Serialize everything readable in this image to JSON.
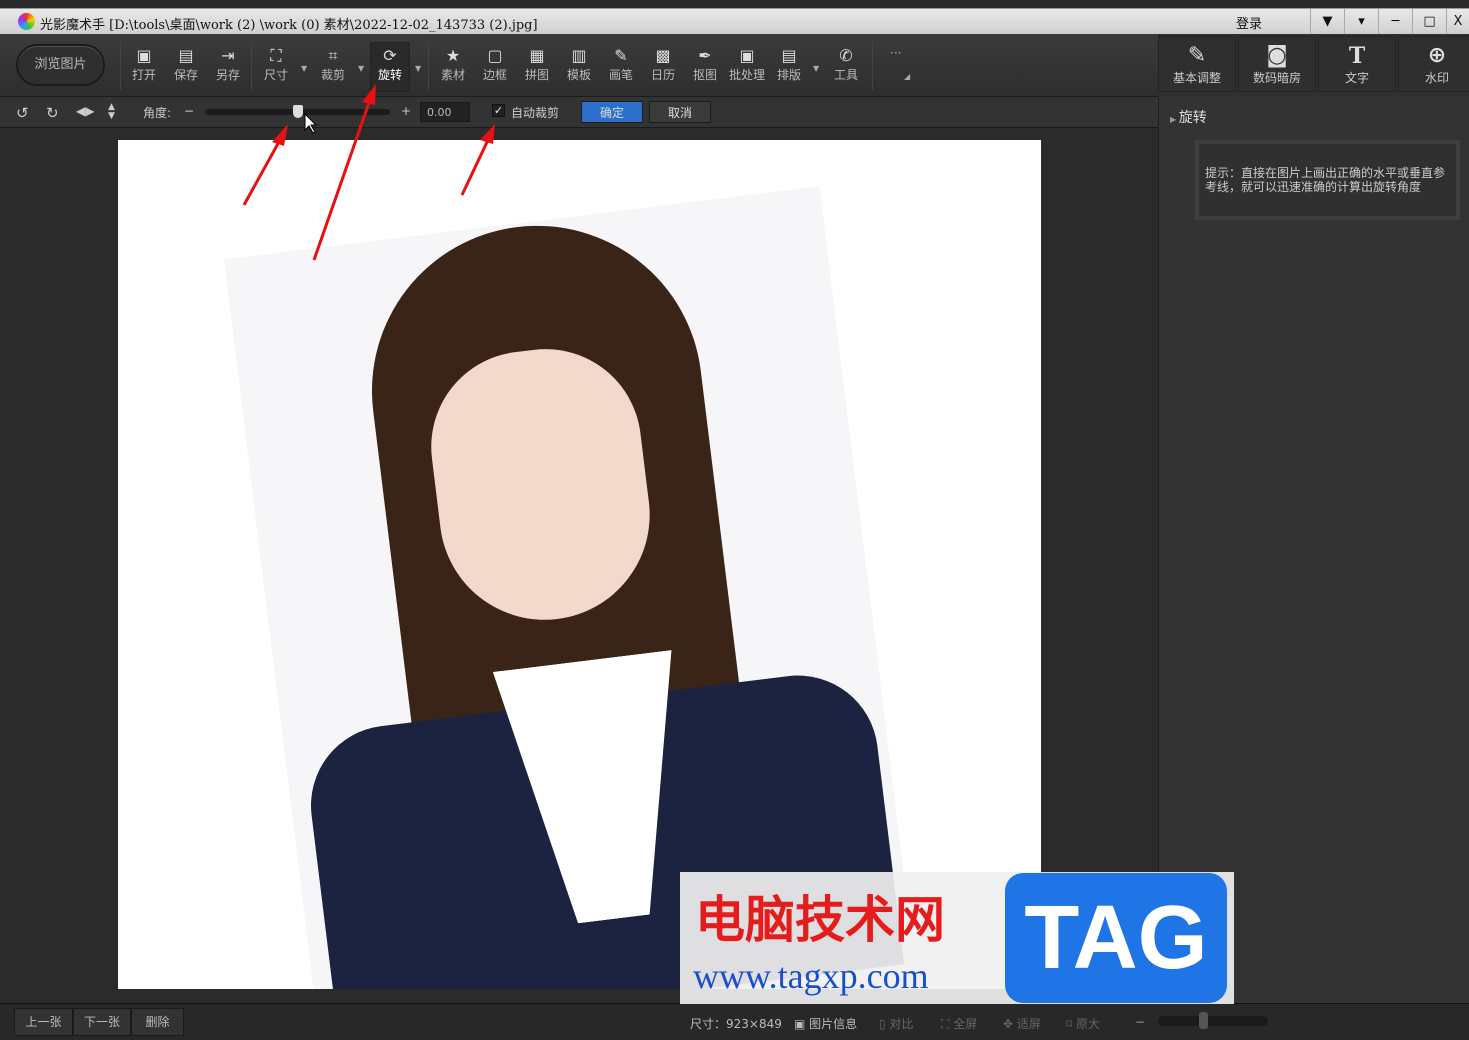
{
  "window": {
    "title": "光影魔术手  [D:\\tools\\桌面\\work (2) \\work (0) 素材\\2022-12-02_143733 (2).jpg]",
    "login": "登录",
    "controls": [
      "▼",
      "▾",
      "─",
      "□",
      "X"
    ]
  },
  "toolbar": {
    "browse": "浏览图片",
    "tools": [
      {
        "label": "打开",
        "icon": "open-icon",
        "glyph": "▣"
      },
      {
        "label": "保存",
        "icon": "save-icon",
        "glyph": "▤"
      },
      {
        "label": "另存",
        "icon": "saveas-icon",
        "glyph": "⇥"
      },
      {
        "label": "尺寸",
        "icon": "resize-icon",
        "glyph": "⛶"
      },
      {
        "label": "裁剪",
        "icon": "crop-icon",
        "glyph": "⌗"
      },
      {
        "label": "旋转",
        "icon": "rotate-icon",
        "glyph": "⟳"
      },
      {
        "label": "素材",
        "icon": "material-icon",
        "glyph": "★"
      },
      {
        "label": "边框",
        "icon": "border-icon",
        "glyph": "▢"
      },
      {
        "label": "拼图",
        "icon": "collage-icon",
        "glyph": "▦"
      },
      {
        "label": "模板",
        "icon": "template-icon",
        "glyph": "▥"
      },
      {
        "label": "画笔",
        "icon": "brush-icon",
        "glyph": "✎"
      },
      {
        "label": "日历",
        "icon": "calendar-icon",
        "glyph": "▩"
      },
      {
        "label": "抠图",
        "icon": "cutout-icon",
        "glyph": "✒"
      },
      {
        "label": "批处理",
        "icon": "batch-icon",
        "glyph": "▣"
      },
      {
        "label": "排版",
        "icon": "layout-icon",
        "glyph": "▤"
      },
      {
        "label": "工具",
        "icon": "wrench-icon",
        "glyph": "✆"
      }
    ],
    "more": "···"
  },
  "right_tools": [
    {
      "label": "基本调整",
      "glyph": "✎"
    },
    {
      "label": "数码暗房",
      "glyph": "◙"
    },
    {
      "label": "文字",
      "glyph": "T"
    },
    {
      "label": "水印",
      "glyph": "⊕"
    }
  ],
  "rotate_bar": {
    "angle_label": "角度:",
    "minus": "−",
    "plus": "+",
    "angle_value": "0.00",
    "slider_fraction": 0.5,
    "auto_crop_label": "自动裁剪",
    "auto_crop_checked": true,
    "confirm": "确定",
    "cancel": "取消"
  },
  "panel": {
    "title": "旋转",
    "tip": "提示：直接在图片上画出正确的水平或垂直参考线，就可以迅速准确的计算出旋转角度"
  },
  "bottom": {
    "prev": "上一张",
    "next": "下一张",
    "delete": "删除",
    "size": "尺寸：923×849",
    "info": "图片信息",
    "compare": "对比",
    "fullscreen": "全屏",
    "fit": "适屏",
    "original": "原大"
  },
  "watermark": {
    "cn": "电脑技术网",
    "url": "www.tagxp.com",
    "tag": "TAG"
  }
}
